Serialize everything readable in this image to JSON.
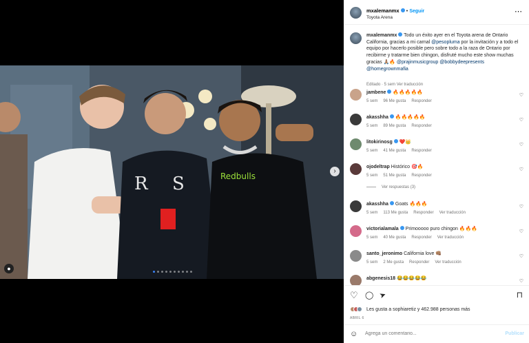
{
  "header": {
    "username": "mxalemanmx",
    "follow_label": "Seguir",
    "location": "Toyota Arena",
    "more_icon": "⋯"
  },
  "caption": {
    "username": "mxalemanmx",
    "text_a": " Todo un éxito ayer en el Toyota arena de Ontario California, gracias a mi carnal ",
    "mention_1": "@pesopluma",
    "text_b": " por la invitación y a todo el equipo por hacerlo posible pero sobre todo a la raza de Ontario por recibirme y tratarme bien chingon, disfruté mucho este show muchas gracias 🙏🏽🔥",
    "mention_2": "@prajinmusicgroup",
    "mention_3": "@bobbydeepresents",
    "mention_4": "@homegrownmafia",
    "meta": "Editado · 5 sem    Ver traducción"
  },
  "comments": [
    {
      "user": "jambene",
      "verified": true,
      "text": "🔥🔥🔥🔥🔥",
      "time": "5 sem",
      "likes": "96 Me gusta",
      "reply": "Responder",
      "translate": ""
    },
    {
      "user": "akasshha",
      "verified": true,
      "text": "🔥🔥🔥🔥🔥",
      "time": "5 sem",
      "likes": "89 Me gusta",
      "reply": "Responder",
      "translate": ""
    },
    {
      "user": "litokirinosg",
      "verified": true,
      "text": "❤️👑",
      "time": "5 sem",
      "likes": "41 Me gusta",
      "reply": "Responder",
      "translate": ""
    },
    {
      "user": "ojodeltrap",
      "verified": false,
      "text": "Histórico 🎯🔥",
      "time": "5 sem",
      "likes": "51 Me gusta",
      "reply": "Responder",
      "translate": ""
    },
    {
      "user": "akasshha",
      "verified": true,
      "text": "Goats 🔥🔥🔥",
      "time": "5 sem",
      "likes": "113 Me gusta",
      "reply": "Responder",
      "translate": "Ver traducción"
    },
    {
      "user": "victorialamala",
      "verified": true,
      "text": "Primooooo puro chingon 🔥🔥🔥",
      "time": "5 sem",
      "likes": "40 Me gusta",
      "reply": "Responder",
      "translate": "Ver traducción"
    },
    {
      "user": "santo_jeronimo",
      "verified": false,
      "text": "California love 👊🏽",
      "time": "5 sem",
      "likes": "2 Me gusta",
      "reply": "Responder",
      "translate": "Ver traducción"
    },
    {
      "user": "abgenesis18",
      "verified": false,
      "text": "😂😂😂😂😂",
      "time": "",
      "likes": "",
      "reply": "",
      "translate": ""
    }
  ],
  "view_replies": "Ver respuestas (3)",
  "actions": {
    "like_icon": "♡",
    "comment_icon": "◯",
    "share_icon": "➤",
    "save_icon": "⊓",
    "likes_text": "Les gusta a sophiaretiz y 462.988 personas más",
    "date": "ABRIL 6"
  },
  "add_comment": {
    "emoji_icon": "☺",
    "placeholder": "Agrega un comentario...",
    "publish": "Publicar"
  },
  "carousel": {
    "dot_count": 10,
    "active_dot": 0
  },
  "colors": {
    "accent": "#0095f6",
    "verified": "#3897f0",
    "mention": "#00376b"
  }
}
